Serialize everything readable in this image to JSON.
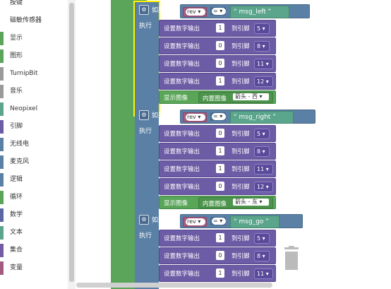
{
  "toolbox": {
    "categories": [
      {
        "label": "按键",
        "color": "#ffffff"
      },
      {
        "label": "磁敏传感器",
        "color": "#ffffff"
      },
      {
        "label": "显示",
        "color": "#5ba55b"
      },
      {
        "label": "图形",
        "color": "#5ba55b"
      },
      {
        "label": "TurnipBit",
        "color": "#9a9a9a"
      },
      {
        "label": "音乐",
        "color": "#9a9a9a"
      },
      {
        "label": "Neopixel",
        "color": "#5ba58c"
      },
      {
        "label": "引脚",
        "color": "#6c5ba5"
      },
      {
        "label": "无线电",
        "color": "#5b80a5"
      },
      {
        "label": "麦克风",
        "color": "#5b80a5"
      },
      {
        "label": "逻辑",
        "color": "#5b80a5"
      },
      {
        "label": "循环",
        "color": "#5ba55b"
      },
      {
        "label": "数学",
        "color": "#5b67a5"
      },
      {
        "label": "文本",
        "color": "#5ba58c"
      },
      {
        "label": "集合",
        "color": "#745ba5"
      },
      {
        "label": "变量",
        "color": "#a55b80"
      }
    ]
  },
  "labels": {
    "if": "如果",
    "do": "执行",
    "set_digital": "设置数字输出",
    "to_pin": "到引脚",
    "show_image": "显示图像",
    "builtin_image": "内置图像",
    "eq": "=",
    "quote_open": "“",
    "quote_close": "”"
  },
  "blocks": [
    {
      "var": "rev",
      "text": "msg_left",
      "outputs": [
        {
          "value": "1",
          "pin": "5"
        },
        {
          "value": "0",
          "pin": "8"
        },
        {
          "value": "0",
          "pin": "11"
        },
        {
          "value": "1",
          "pin": "12"
        }
      ],
      "image": "箭头 - 西"
    },
    {
      "var": "rev",
      "text": "msg_right",
      "outputs": [
        {
          "value": "0",
          "pin": "5"
        },
        {
          "value": "1",
          "pin": "8"
        },
        {
          "value": "1",
          "pin": "11"
        },
        {
          "value": "0",
          "pin": "12"
        }
      ],
      "image": "箭头 - 东"
    },
    {
      "var": "rev",
      "text": "msg_go",
      "outputs": [
        {
          "value": "1",
          "pin": "5"
        },
        {
          "value": "0",
          "pin": "8"
        },
        {
          "value": "1",
          "pin": "11"
        }
      ],
      "image": null
    }
  ],
  "colors": {
    "control": "#5b80a5",
    "digital": "#6c5ba5",
    "display": "#5ba55b",
    "text": "#5ba58c",
    "variable": "#a55b80",
    "selection": "#fff200"
  }
}
